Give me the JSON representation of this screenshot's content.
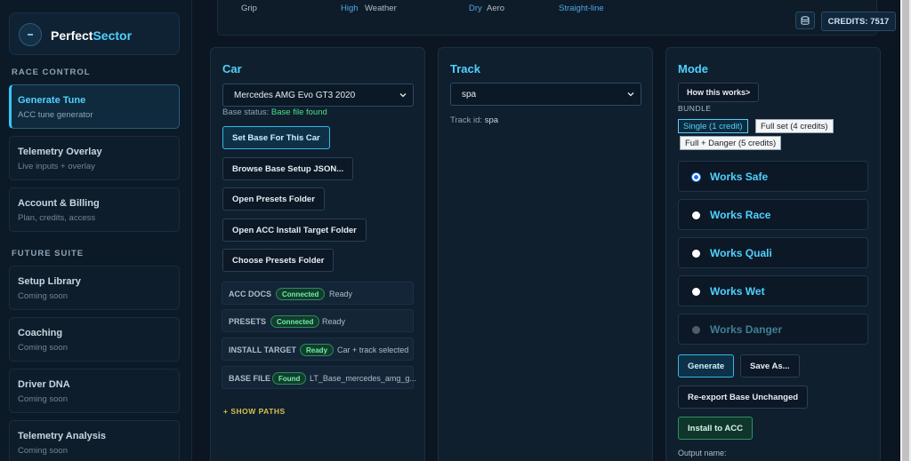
{
  "app": {
    "name_part1": "Perfect",
    "name_part2": "Sector",
    "logo_icon": "minus-icon"
  },
  "sidebar": {
    "sections": [
      {
        "title": "RACE CONTROL",
        "items": [
          {
            "label": "Generate Tune",
            "sub": "ACC tune generator",
            "active": true
          },
          {
            "label": "Telemetry Overlay",
            "sub": "Live inputs + overlay"
          },
          {
            "label": "Account & Billing",
            "sub": "Plan, credits, access"
          }
        ]
      },
      {
        "title": "FUTURE SUITE",
        "items": [
          {
            "label": "Setup Library",
            "sub": "Coming soon"
          },
          {
            "label": "Coaching",
            "sub": "Coming soon"
          },
          {
            "label": "Driver DNA",
            "sub": "Coming soon"
          },
          {
            "label": "Telemetry Analysis",
            "sub": "Coming soon"
          }
        ]
      }
    ]
  },
  "top_strip": {
    "items": [
      {
        "text": "Grip",
        "color": "#aebdcb"
      },
      {
        "text": "High",
        "color": "#4fa6e8"
      },
      {
        "text": "Weather",
        "color": "#aebdcb"
      },
      {
        "text": "Dry",
        "color": "#4fa6e8"
      },
      {
        "text": "Aero",
        "color": "#aebdcb"
      },
      {
        "text": "Straight-line",
        "color": "#4fa6e8"
      }
    ]
  },
  "header": {
    "credits_label": "CREDITS: 7517",
    "db_icon": "database-icon"
  },
  "car_panel": {
    "title": "Car",
    "car_select_value": "Mercedes AMG Evo GT3 2020",
    "base_status_label": "Base status:",
    "base_status_value": "Base file found",
    "buttons": {
      "set_base": "Set Base For This Car",
      "browse": "Browse Base Setup JSON...",
      "open_presets": "Open Presets Folder",
      "open_install": "Open ACC Install Target Folder",
      "choose_presets": "Choose Presets Folder"
    },
    "status_rows": [
      {
        "key": "ACC DOCS",
        "badge": "Connected",
        "value": "Ready"
      },
      {
        "key": "PRESETS",
        "badge": "Connected",
        "value": "Ready"
      },
      {
        "key": "INSTALL TARGET",
        "badge": "Ready",
        "value": "Car + track selected"
      },
      {
        "key": "BASE FILE",
        "badge": "Found",
        "value": "LT_Base_mercedes_amg_g..."
      }
    ],
    "show_paths": "+ SHOW PATHS"
  },
  "track_panel": {
    "title": "Track",
    "track_select_value": "spa",
    "track_id_label": "Track id:",
    "track_id_value": "spa"
  },
  "mode_panel": {
    "title": "Mode",
    "how_button": "How this works>",
    "bundle_label": "BUNDLE",
    "bundle_options": {
      "single": "Single (1 credit)",
      "full": "Full set (4 credits)",
      "danger": "Full + Danger (5 credits)"
    },
    "modes": [
      {
        "label": "Works Safe",
        "checked": true
      },
      {
        "label": "Works Race"
      },
      {
        "label": "Works Quali"
      },
      {
        "label": "Works Wet"
      },
      {
        "label": "Works Danger",
        "disabled": true
      }
    ],
    "buttons": {
      "generate": "Generate",
      "save_as": "Save As...",
      "reexport": "Re-export Base Unchanged",
      "install": "Install to ACC"
    },
    "output_label": "Output name:"
  },
  "colors": {
    "accent": "#4fd1ff",
    "background": "#0b1622",
    "success": "#48e08a",
    "warning": "#d8c04a"
  }
}
